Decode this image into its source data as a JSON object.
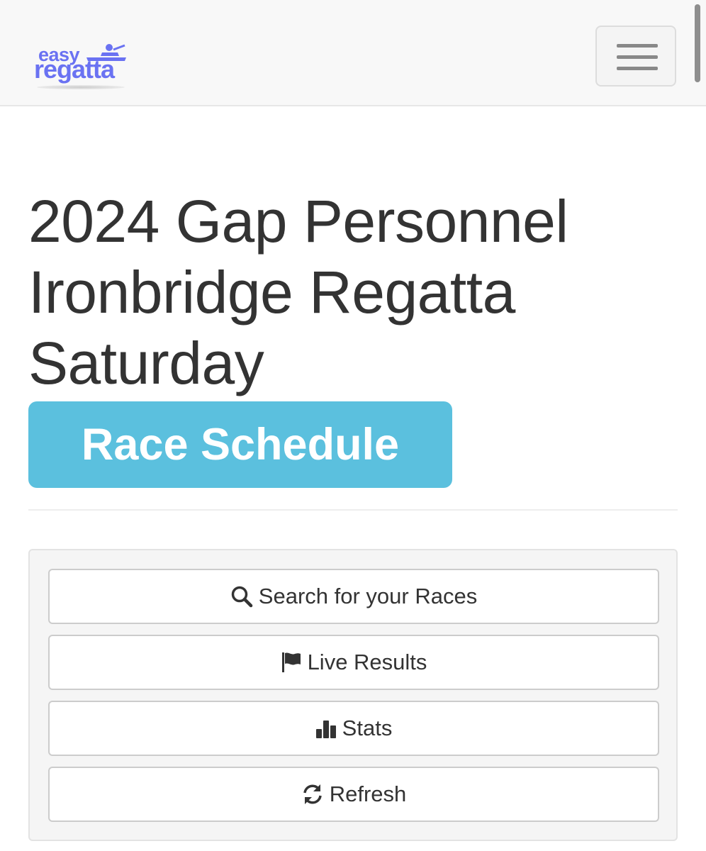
{
  "brand": {
    "logo_top": "easy",
    "logo_bottom": "regatta",
    "color": "#6a72f2"
  },
  "navbar": {
    "menu_icon": "hamburger-menu-icon"
  },
  "page": {
    "title": "2024 Gap Personnel Ironbridge Regatta Saturday",
    "label": "Race Schedule",
    "label_color": "#5bc0de"
  },
  "actions": [
    {
      "label": "Search for your Races",
      "icon": "search-icon"
    },
    {
      "label": "Live Results",
      "icon": "flag-icon"
    },
    {
      "label": "Stats",
      "icon": "bar-chart-icon"
    },
    {
      "label": "Refresh",
      "icon": "refresh-icon"
    }
  ]
}
